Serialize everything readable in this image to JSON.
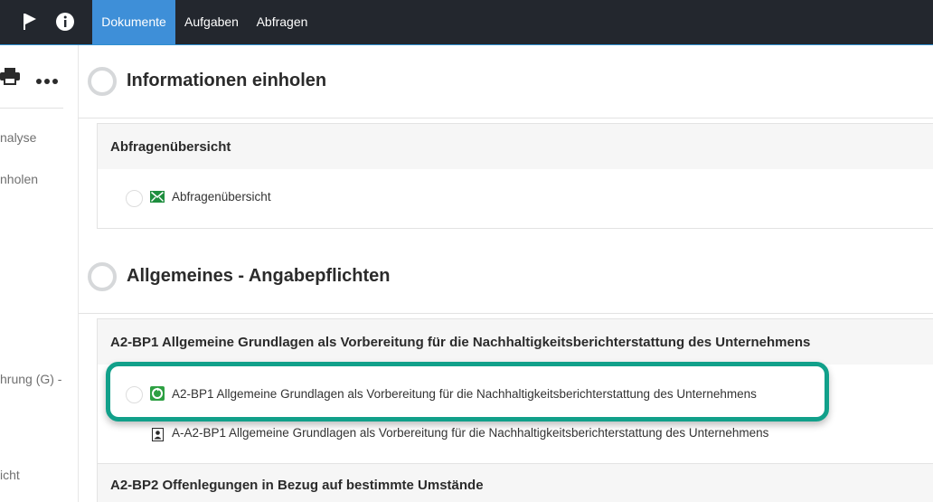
{
  "topbar": {
    "icons": [
      "flag-icon",
      "info-icon"
    ],
    "tabs": [
      {
        "label": "Dokumente",
        "active": true
      },
      {
        "label": "Aufgaben",
        "active": false
      },
      {
        "label": "Abfragen",
        "active": false
      }
    ],
    "accent": "#3e8fd8",
    "background": "#23272e"
  },
  "sidebar": {
    "tools": [
      "print-icon",
      "more-icon"
    ],
    "items": [
      "nalyse",
      "nholen",
      "hrung (G) -",
      "icht"
    ]
  },
  "sections": [
    {
      "title": "Informationen einholen",
      "cards": [
        {
          "title": "Abfragenübersicht",
          "items": [
            {
              "label": "Abfragenübersicht",
              "icon": "envelope-icon"
            }
          ]
        }
      ]
    },
    {
      "title": "Allgemeines - Angabepflichten",
      "cards": [
        {
          "title": "A2-BP1 Allgemeine Grundlagen als Vorbereitung für die Nachhaltigkeitsberichterstattung des Unternehmens",
          "items": [
            {
              "label": "A2-BP1 Allgemeine Grundlagen als Vorbereitung für die Nachhaltigkeitsberichterstattung des Unternehmens",
              "icon": "recycle-icon",
              "highlighted": true
            },
            {
              "label": "A-A2-BP1 Allgemeine Grundlagen als Vorbereitung für die Nachhaltigkeitsberichterstattung des Unternehmens",
              "icon": "document-user-icon"
            }
          ]
        },
        {
          "title": "A2-BP2 Offenlegungen in Bezug auf bestimmte Umstände",
          "items": []
        }
      ]
    }
  ],
  "colors": {
    "highlight": "#11a08a",
    "green_icon": "#1e8e3e"
  }
}
